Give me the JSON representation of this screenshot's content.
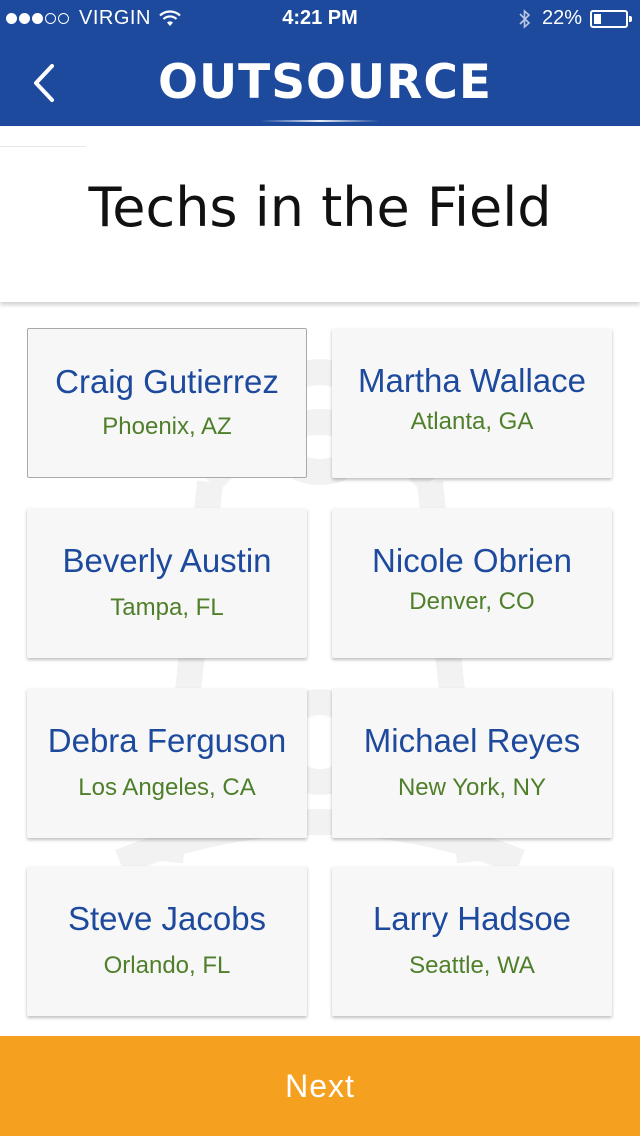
{
  "status_bar": {
    "carrier": "VIRGIN",
    "time": "4:21 PM",
    "battery": "22%",
    "battery_level": 0.22,
    "icons": [
      "signal-dots-icon",
      "wifi-icon",
      "bluetooth-icon",
      "battery-icon"
    ]
  },
  "nav": {
    "back_icon": "chevron-left-icon",
    "logo_text": "OUTSOURCE"
  },
  "page": {
    "title": "Techs in the Field"
  },
  "techs": [
    {
      "name": "Craig Gutierrez",
      "location": "Phoenix, AZ",
      "selected": true
    },
    {
      "name": "Martha Wallace",
      "location": "Atlanta, GA",
      "selected": false
    },
    {
      "name": "Beverly Austin",
      "location": "Tampa, FL",
      "selected": false
    },
    {
      "name": "Nicole Obrien",
      "location": "Denver, CO",
      "selected": false
    },
    {
      "name": "Debra Ferguson",
      "location": "Los Angeles, CA",
      "selected": false
    },
    {
      "name": "Michael Reyes",
      "location": "New York, NY",
      "selected": false
    },
    {
      "name": "Steve Jacobs",
      "location": "Orlando, FL",
      "selected": false
    },
    {
      "name": "Larry Hadsoe",
      "location": "Seattle, WA",
      "selected": false
    }
  ],
  "footer": {
    "next_label": "Next"
  },
  "colors": {
    "header_blue": "#1e4a9e",
    "name_blue": "#1e4a9e",
    "location_green": "#4f7f2a",
    "next_orange": "#f5a11f",
    "card_bg": "#f7f7f7"
  }
}
